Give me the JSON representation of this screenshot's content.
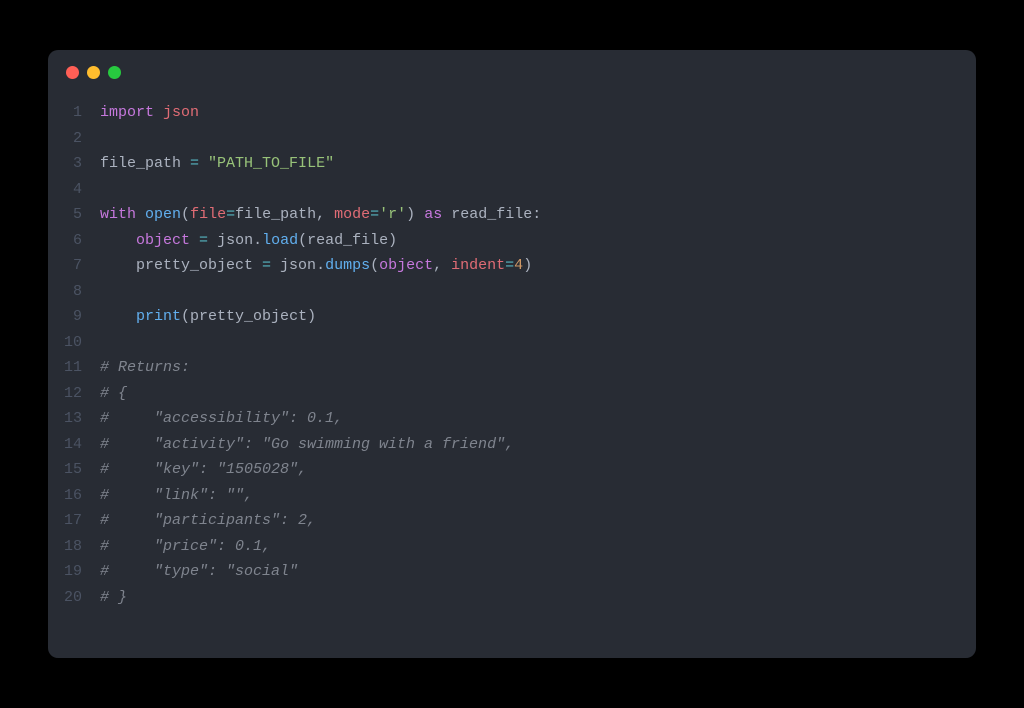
{
  "window": {
    "traffic_lights": {
      "red": "#ff5f56",
      "yellow": "#ffbd2e",
      "green": "#27c93f"
    }
  },
  "code": {
    "lines": [
      {
        "n": "1",
        "tokens": [
          [
            "kw",
            "import"
          ],
          [
            "id",
            " "
          ],
          [
            "mod",
            "json"
          ]
        ]
      },
      {
        "n": "2",
        "tokens": []
      },
      {
        "n": "3",
        "tokens": [
          [
            "id",
            "file_path "
          ],
          [
            "op",
            "="
          ],
          [
            "id",
            " "
          ],
          [
            "str",
            "\"PATH_TO_FILE\""
          ]
        ]
      },
      {
        "n": "4",
        "tokens": []
      },
      {
        "n": "5",
        "tokens": [
          [
            "kw",
            "with"
          ],
          [
            "id",
            " "
          ],
          [
            "fn",
            "open"
          ],
          [
            "punct",
            "("
          ],
          [
            "mod",
            "file"
          ],
          [
            "op",
            "="
          ],
          [
            "id",
            "file_path"
          ],
          [
            "punct",
            ", "
          ],
          [
            "mod",
            "mode"
          ],
          [
            "op",
            "="
          ],
          [
            "str",
            "'r'"
          ],
          [
            "punct",
            ")"
          ],
          [
            "id",
            " "
          ],
          [
            "kw",
            "as"
          ],
          [
            "id",
            " read_file"
          ],
          [
            "punct",
            ":"
          ]
        ]
      },
      {
        "n": "6",
        "tokens": [
          [
            "id",
            "    "
          ],
          [
            "kw",
            "object"
          ],
          [
            "id",
            " "
          ],
          [
            "op",
            "="
          ],
          [
            "id",
            " json"
          ],
          [
            "punct",
            "."
          ],
          [
            "fn",
            "load"
          ],
          [
            "punct",
            "("
          ],
          [
            "id",
            "read_file"
          ],
          [
            "punct",
            ")"
          ]
        ]
      },
      {
        "n": "7",
        "tokens": [
          [
            "id",
            "    pretty_object "
          ],
          [
            "op",
            "="
          ],
          [
            "id",
            " json"
          ],
          [
            "punct",
            "."
          ],
          [
            "fn",
            "dumps"
          ],
          [
            "punct",
            "("
          ],
          [
            "kw",
            "object"
          ],
          [
            "punct",
            ", "
          ],
          [
            "mod",
            "indent"
          ],
          [
            "op",
            "="
          ],
          [
            "num",
            "4"
          ],
          [
            "punct",
            ")"
          ]
        ]
      },
      {
        "n": "8",
        "tokens": []
      },
      {
        "n": "9",
        "tokens": [
          [
            "id",
            "    "
          ],
          [
            "fn",
            "print"
          ],
          [
            "punct",
            "("
          ],
          [
            "id",
            "pretty_object"
          ],
          [
            "punct",
            ")"
          ]
        ]
      },
      {
        "n": "10",
        "tokens": []
      },
      {
        "n": "11",
        "tokens": [
          [
            "cm",
            "# Returns:"
          ]
        ]
      },
      {
        "n": "12",
        "tokens": [
          [
            "cm",
            "# {"
          ]
        ]
      },
      {
        "n": "13",
        "tokens": [
          [
            "cm",
            "#     \"accessibility\": 0.1,"
          ]
        ]
      },
      {
        "n": "14",
        "tokens": [
          [
            "cm",
            "#     \"activity\": \"Go swimming with a friend\","
          ]
        ]
      },
      {
        "n": "15",
        "tokens": [
          [
            "cm",
            "#     \"key\": \"1505028\","
          ]
        ]
      },
      {
        "n": "16",
        "tokens": [
          [
            "cm",
            "#     \"link\": \"\","
          ]
        ]
      },
      {
        "n": "17",
        "tokens": [
          [
            "cm",
            "#     \"participants\": 2,"
          ]
        ]
      },
      {
        "n": "18",
        "tokens": [
          [
            "cm",
            "#     \"price\": 0.1,"
          ]
        ]
      },
      {
        "n": "19",
        "tokens": [
          [
            "cm",
            "#     \"type\": \"social\""
          ]
        ]
      },
      {
        "n": "20",
        "tokens": [
          [
            "cm",
            "# }"
          ]
        ]
      }
    ]
  }
}
